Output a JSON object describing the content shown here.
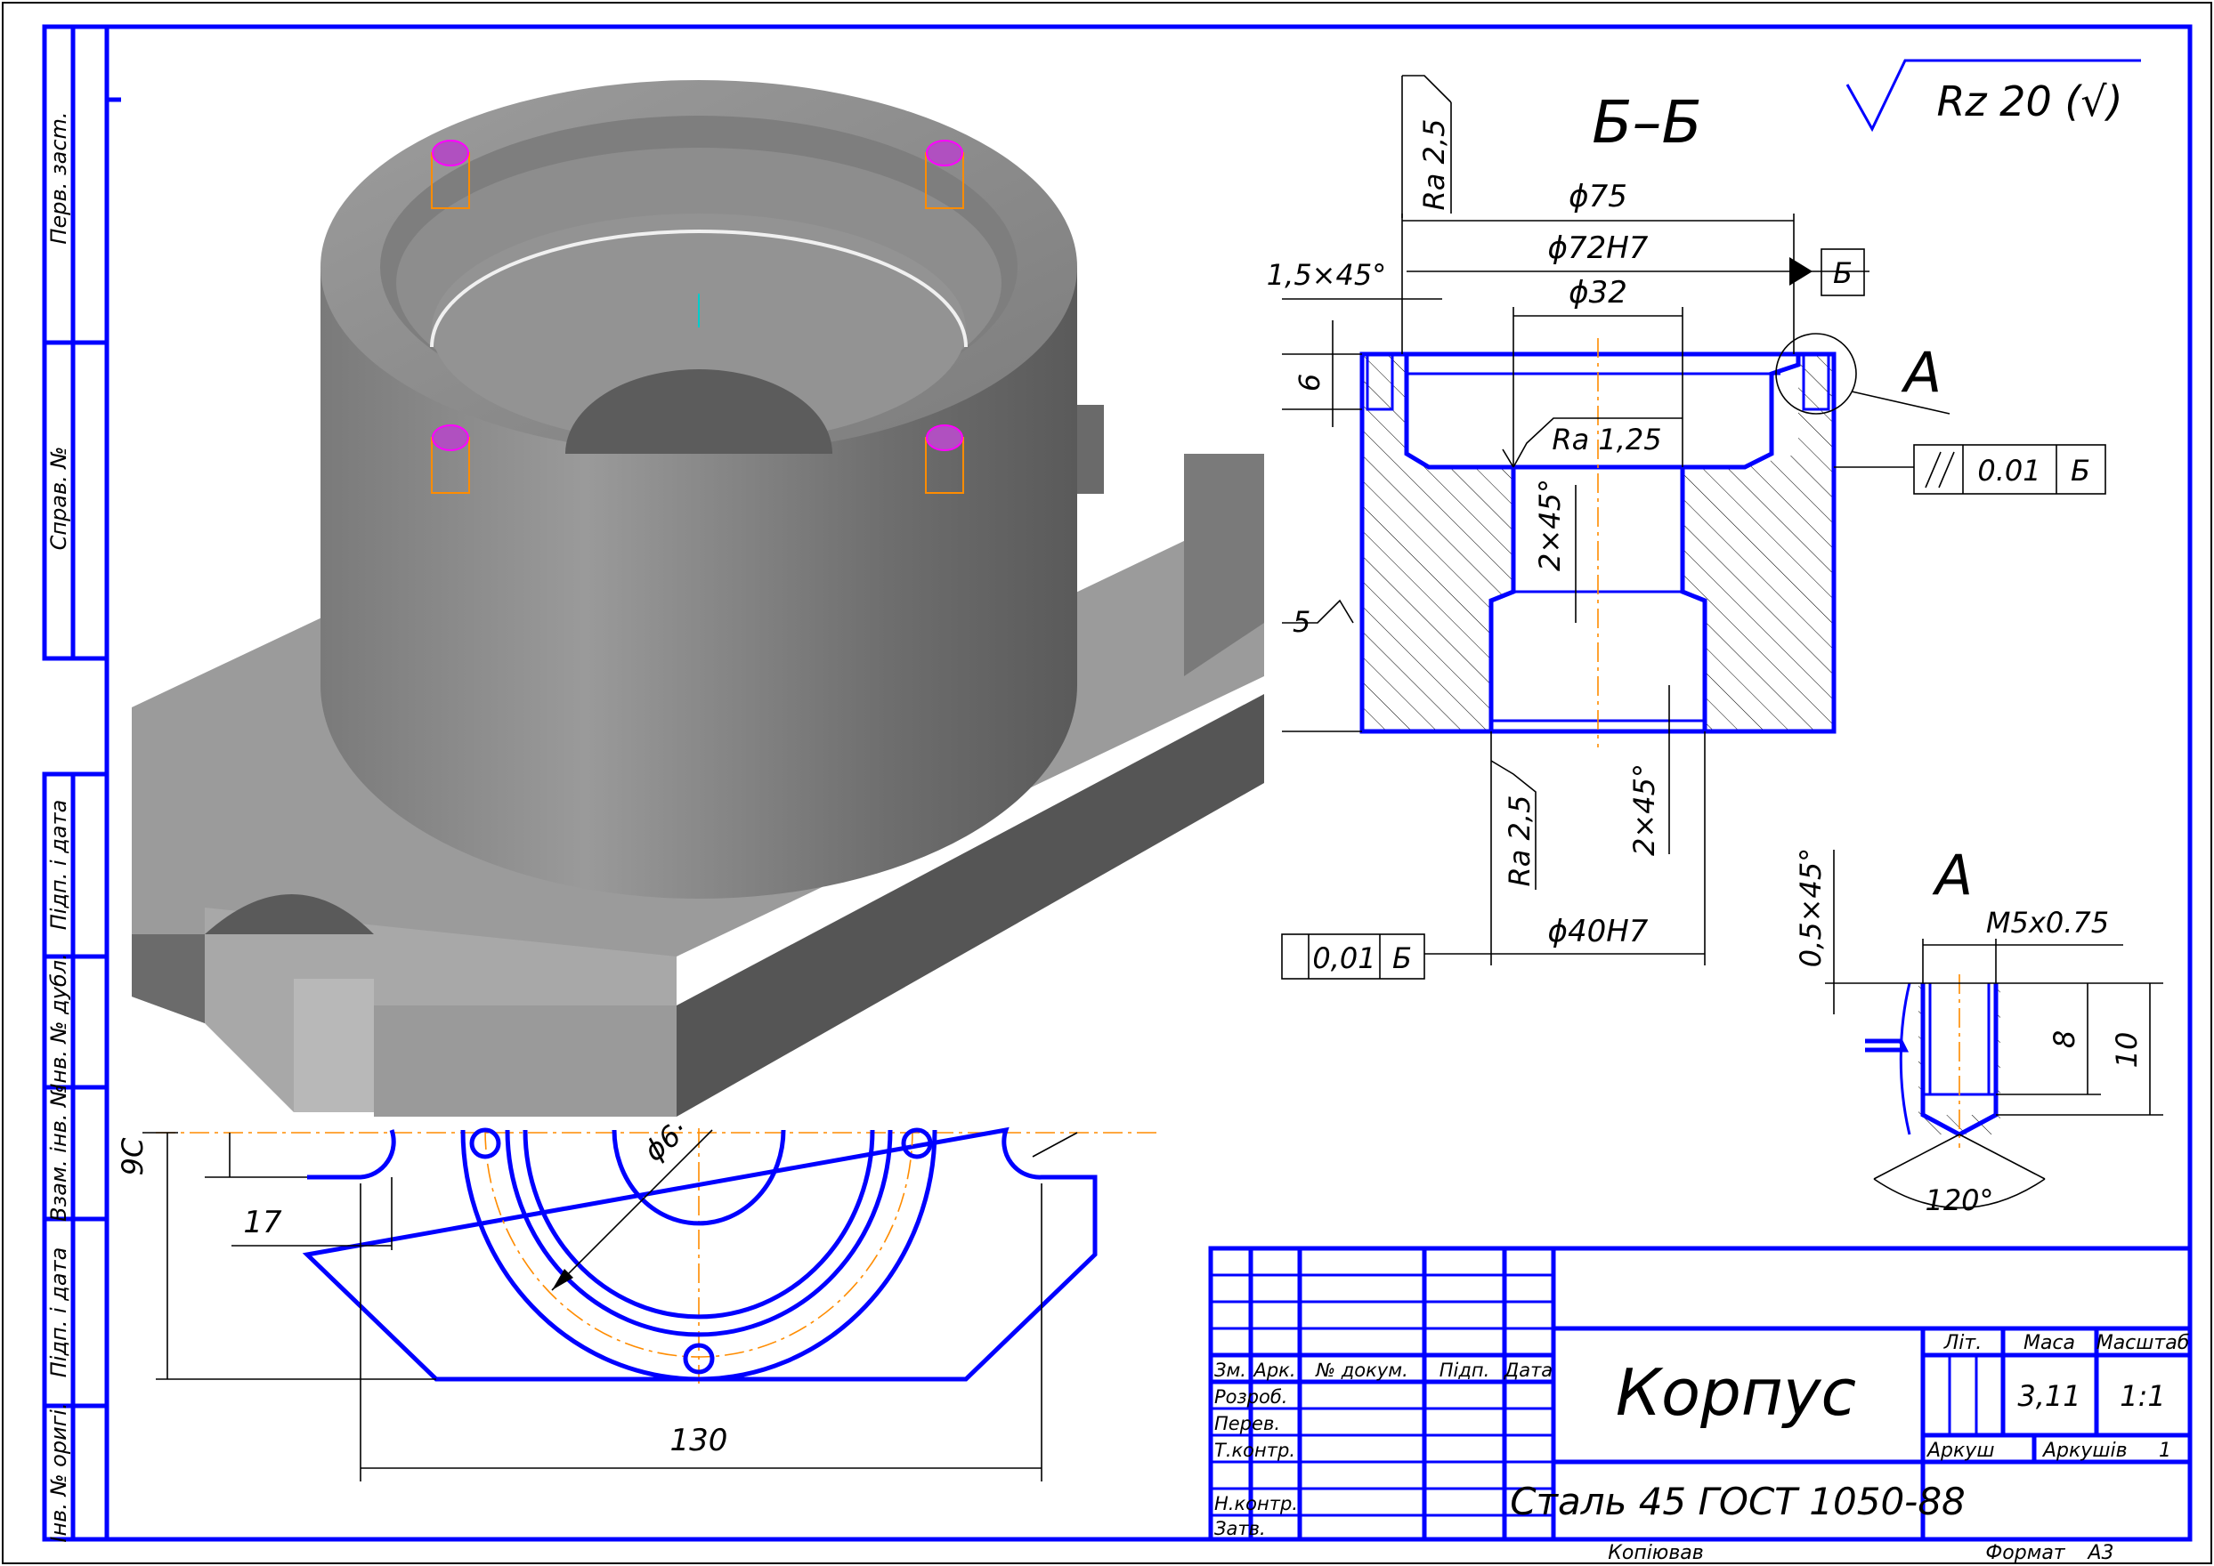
{
  "colors": {
    "outline": "#0000ff",
    "dimension": "#000000",
    "axis": "#ff8c00",
    "model_shade": "#8c8c8c"
  },
  "side_stamps": [
    "Перв. засm.",
    "Справ. №",
    "Підп. і дата",
    "Інв. № дубл.",
    "Взам. інв. №",
    "Підп. і дата",
    "Інв. № оригі."
  ],
  "section": {
    "title": "Б–Б",
    "dims": {
      "d75": "ϕ75",
      "d72": "ϕ72H7",
      "d32": "ϕ32",
      "chamfer_top": "1,5×45°",
      "depth6": "6",
      "ra_inner": "Ra 1,25",
      "chamfer_mid": "2×45°",
      "chamfer_bot": "2×45°",
      "d40": "ϕ40H7",
      "ra_top": "Ra 2,5",
      "ra_bottom": "Ra 2,5",
      "ra_left_partial": "5"
    },
    "datum": "Б",
    "tol_parallel": {
      "value": "0.01",
      "datum": "Б"
    },
    "tol_runout": {
      "value": "0,01",
      "datum": "Б"
    },
    "detail_marker": "А"
  },
  "roughness_note": "Rz 20 (√)",
  "detail": {
    "title": "А",
    "thread": "M5x0.75",
    "chamfer": "0,5×45°",
    "depth8": "8",
    "depth10": "10",
    "angle": "120°"
  },
  "plan": {
    "dim_130": "130",
    "dim_17": "17",
    "dim_left_partial": "9С",
    "dim_diam_partial": "ϕ6·"
  },
  "title_block": {
    "name": "Корпус",
    "material": "Сталь 45  ГОСТ 1050-88",
    "headers": {
      "lit": "Літ.",
      "mass": "Маса",
      "scale": "Масштаб"
    },
    "mass": "3,11",
    "scale": "1:1",
    "sheet_label": "Аркуш",
    "sheets_label": "Аркушів",
    "sheets_value": "1",
    "col_headers": [
      "Зм.",
      "Арк.",
      "№ докум.",
      "Підп.",
      "Дата"
    ],
    "roles": [
      "Розроб.",
      "Перев.",
      "Т.контр.",
      "Н.контр.",
      "Затв."
    ]
  },
  "footer": {
    "copied": "Копіював",
    "format_label": "Формат",
    "format_value": "А3"
  }
}
